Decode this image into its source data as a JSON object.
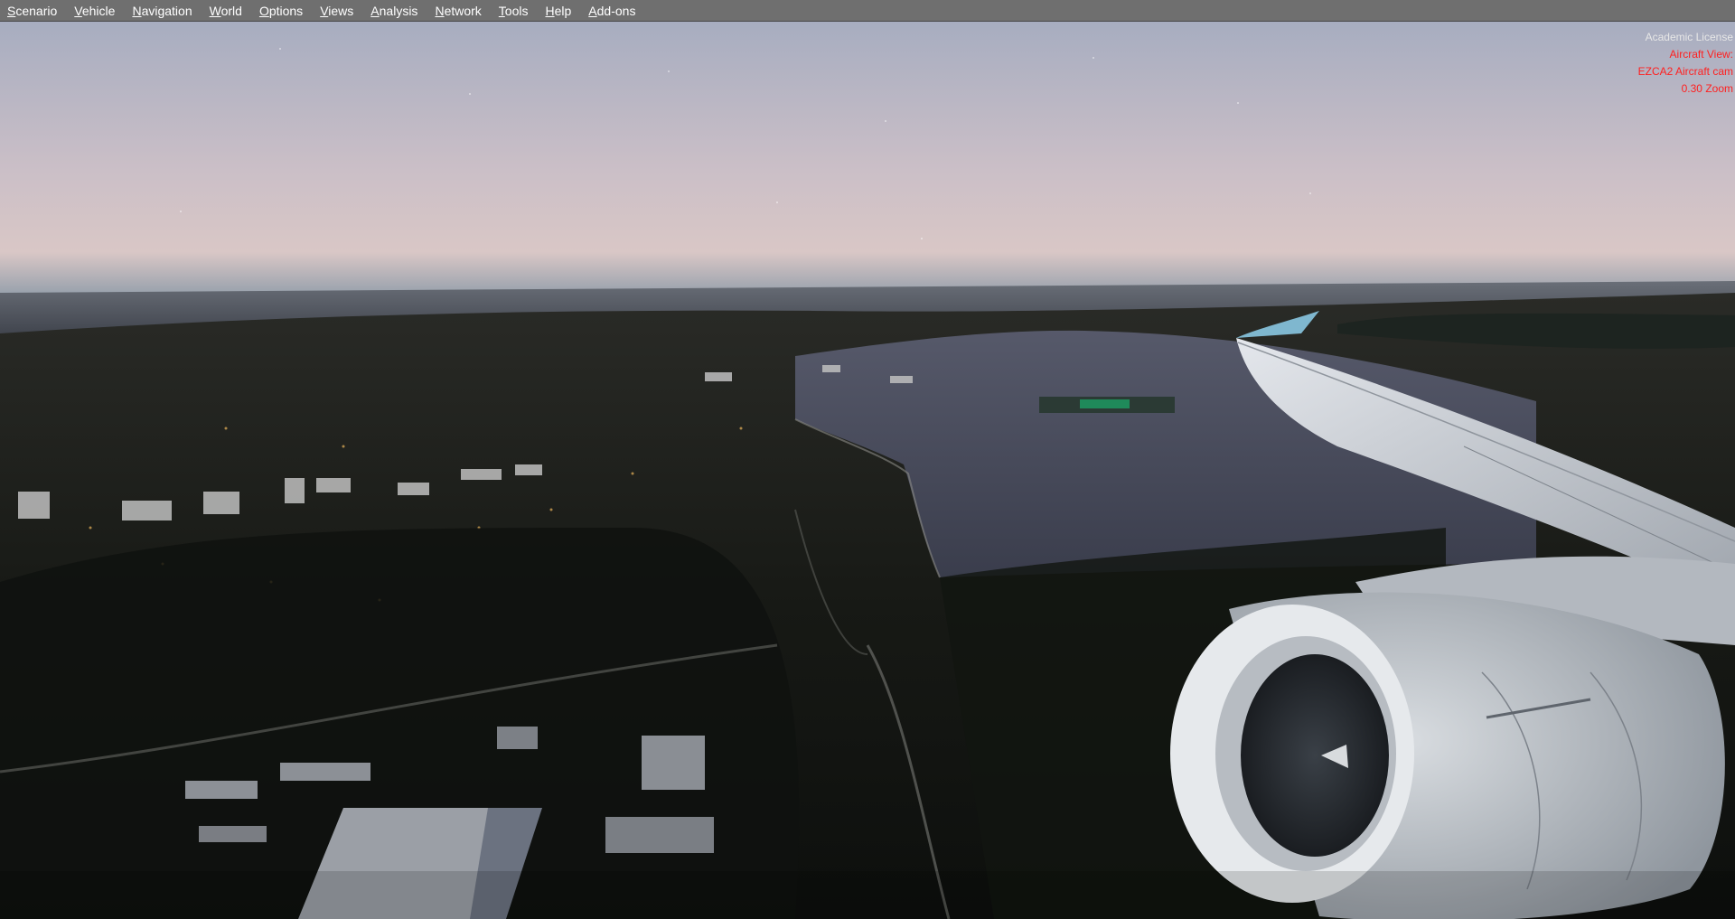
{
  "menubar": {
    "items": [
      {
        "id": "scenario",
        "label": "Scenario"
      },
      {
        "id": "vehicle",
        "label": "Vehicle"
      },
      {
        "id": "navigation",
        "label": "Navigation"
      },
      {
        "id": "world",
        "label": "World"
      },
      {
        "id": "options",
        "label": "Options"
      },
      {
        "id": "views",
        "label": "Views"
      },
      {
        "id": "analysis",
        "label": "Analysis"
      },
      {
        "id": "network",
        "label": "Network"
      },
      {
        "id": "tools",
        "label": "Tools"
      },
      {
        "id": "help",
        "label": "Help"
      },
      {
        "id": "addons",
        "label": "Add-ons"
      }
    ]
  },
  "hud": {
    "license": "Academic License",
    "view_mode": "Aircraft View:",
    "camera": "EZCA2 Aircraft cam",
    "zoom": "0.30 Zoom"
  },
  "colors": {
    "menubar_bg": "#6f6f6f",
    "hud_license": "#e6e6e6",
    "hud_status": "#ff2020",
    "sky_top": "#a8adbf",
    "sky_horizon": "#d7c4c4",
    "sea": "#4b4f5a",
    "engine": "#c9cdd2"
  }
}
